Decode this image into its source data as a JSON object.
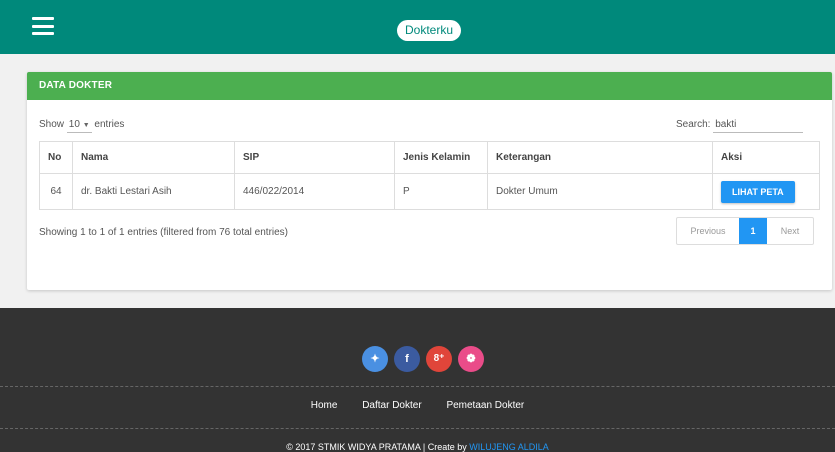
{
  "header": {
    "brand": "Dokterku"
  },
  "card": {
    "title": "DATA DOKTER",
    "show_prefix": "Show",
    "show_value": "10",
    "show_suffix": "entries",
    "search_label": "Search:",
    "search_value": "bakti",
    "columns": [
      "No",
      "Nama",
      "SIP",
      "Jenis Kelamin",
      "Keterangan",
      "Aksi"
    ],
    "rows": [
      {
        "no": "64",
        "nama": "dr. Bakti Lestari Asih",
        "sip": "446/022/2014",
        "jk": "P",
        "ket": "Dokter Umum",
        "aksi": "LIHAT PETA"
      }
    ],
    "info": "Showing 1 to 1 of 1 entries (filtered from 76 total entries)",
    "pager": {
      "prev": "Previous",
      "current": "1",
      "next": "Next"
    }
  },
  "footer": {
    "socials": [
      {
        "name": "twitter",
        "glyph": "✦",
        "color": "#4a90e2"
      },
      {
        "name": "facebook",
        "glyph": "f",
        "color": "#3b5ba0"
      },
      {
        "name": "google-plus",
        "glyph": "8⁺",
        "color": "#e0453a"
      },
      {
        "name": "dribbble",
        "glyph": "❁",
        "color": "#ea4c89"
      }
    ],
    "nav": [
      "Home",
      "Daftar Dokter",
      "Pemetaan Dokter"
    ],
    "copyright": "© 2017 STMIK WIDYA PRATAMA | Create by ",
    "author": "WILUJENG ALDILA"
  }
}
